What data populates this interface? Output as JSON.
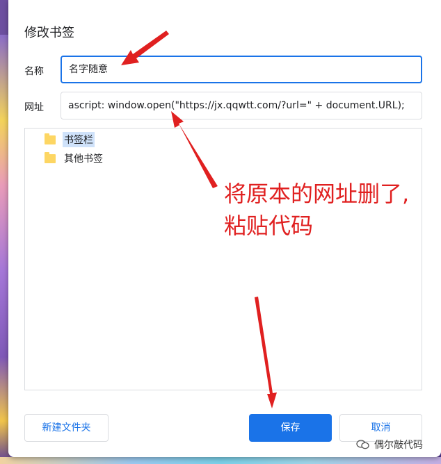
{
  "dialog": {
    "title": "修改书签",
    "name_label": "名称",
    "name_value": "名字随意",
    "url_label": "网址",
    "url_value": "ascript: window.open(\"https://jx.qqwtt.com/?url=\" + document.URL);",
    "folders": [
      {
        "label": "书签栏",
        "selected": true
      },
      {
        "label": "其他书签",
        "selected": false
      }
    ],
    "buttons": {
      "new_folder": "新建文件夹",
      "save": "保存",
      "cancel": "取消"
    }
  },
  "annotation": {
    "line1": "将原本的网址删了,",
    "line2": "粘贴代码"
  },
  "watermark": {
    "text": "偶尔敲代码",
    "icon": "wechat-icon"
  },
  "colors": {
    "accent": "#1a73e8",
    "annotation": "#e02020",
    "folder": "#fdd663",
    "selection": "#cfe2fa"
  }
}
